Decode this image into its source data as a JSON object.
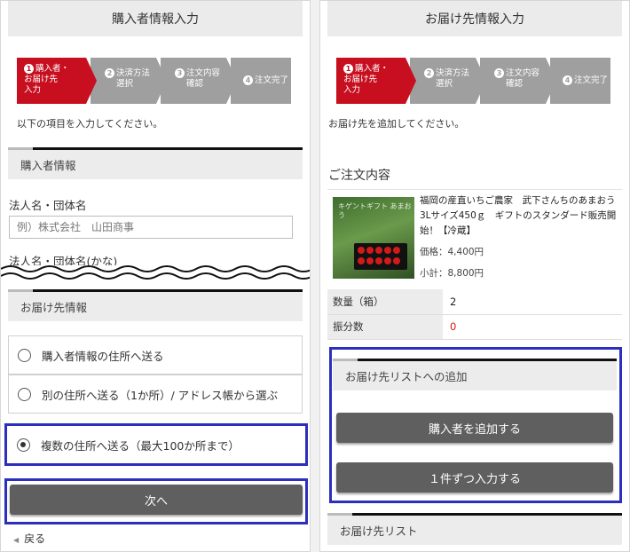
{
  "left": {
    "header": "購入者情報入力",
    "steps": [
      {
        "num": "1",
        "label_lines": [
          "購入者・",
          "お届け先",
          "入力"
        ]
      },
      {
        "num": "2",
        "label_lines": [
          "決済方法",
          "選択"
        ]
      },
      {
        "num": "3",
        "label_lines": [
          "注文内容",
          "確認"
        ]
      },
      {
        "num": "4",
        "label_lines": [
          "注文完了"
        ]
      }
    ],
    "intro": "以下の項目を入力してください。",
    "buyer_section_title": "購入者情報",
    "company_label": "法人名・団体名",
    "company_placeholder": "例）株式会社　山田商事",
    "company_kana_label": "法人名・団体名(かな)",
    "delivery_section_title": "お届け先情報",
    "options": [
      {
        "label": "購入者情報の住所へ送る",
        "selected": false
      },
      {
        "label": "別の住所へ送る（1か所）/ アドレス帳から選ぶ",
        "selected": false
      },
      {
        "label": "複数の住所へ送る（最大100か所まで）",
        "selected": true
      }
    ],
    "next_button": "次へ",
    "back_link": "戻る"
  },
  "right": {
    "header": "お届け先情報入力",
    "steps": [
      {
        "num": "1",
        "label_lines": [
          "購入者・",
          "お届け先",
          "入力"
        ]
      },
      {
        "num": "2",
        "label_lines": [
          "決済方法",
          "選択"
        ]
      },
      {
        "num": "3",
        "label_lines": [
          "注文内容",
          "確認"
        ]
      },
      {
        "num": "4",
        "label_lines": [
          "注文完了"
        ]
      }
    ],
    "intro": "お届け先を追加してください。",
    "order_title": "ご注文内容",
    "product": {
      "name": "福岡の産直いちご農家　武下さんちのあまおう3Lサイズ450ｇ　ギフトのスタンダード販売開始！【冷蔵】",
      "price": "価格：4,400円",
      "subtotal": "小計：8,800円",
      "image_caption": "キゲントギフト あまおう"
    },
    "rows": [
      {
        "key": "数量（箱）",
        "value": "2"
      },
      {
        "key": "振分数",
        "value": "0"
      }
    ],
    "add_section_title": "お届け先リストへの追加",
    "add_buyer_button": "購入者を追加する",
    "add_one_button": "１件ずつ入力する",
    "list_section_title": "お届け先リスト"
  },
  "colors": {
    "active_step": "#c70f1f",
    "inactive_step": "#9f9f9f",
    "highlight": "#2b2fbb",
    "button": "#5f5f5f"
  }
}
